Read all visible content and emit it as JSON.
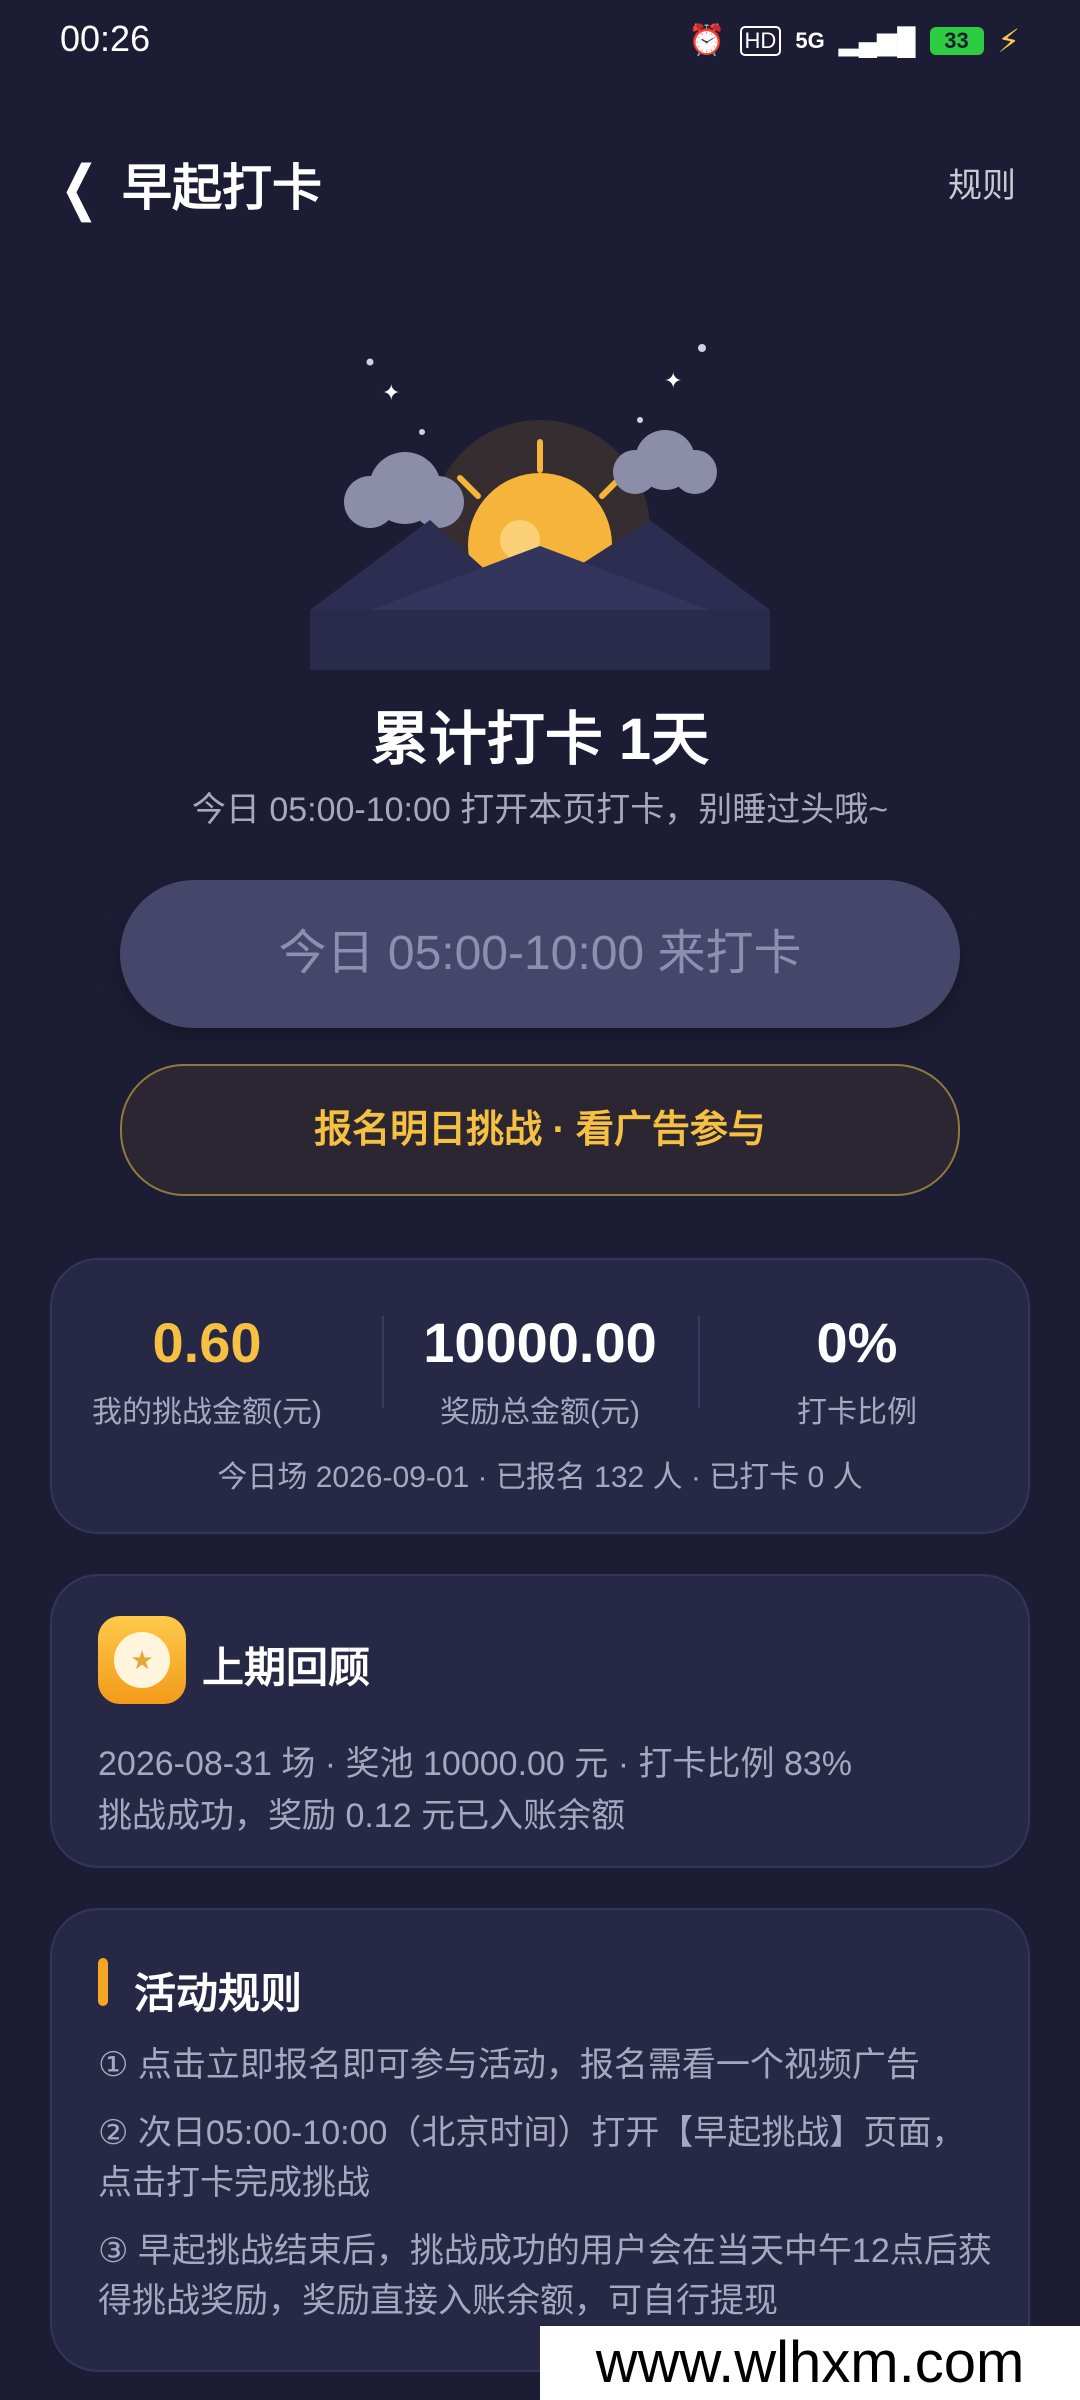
{
  "status_bar": {
    "time": "00:26",
    "battery": "33",
    "network": "5G"
  },
  "header": {
    "title": "早起打卡",
    "rules_link": "规则"
  },
  "hero": {
    "days_text": "累计打卡 1天",
    "tip": "今日 05:00-10:00 打开本页打卡，别睡过头哦~"
  },
  "buttons": {
    "checkin": "今日 05:00-10:00 来打卡",
    "signup": "报名明日挑战 · 看广告参与"
  },
  "stats": {
    "items": [
      {
        "value": "0.60",
        "label": "我的挑战金额(元)"
      },
      {
        "value": "10000.00",
        "label": "奖励总金额(元)"
      },
      {
        "value": "0%",
        "label": "打卡比例"
      }
    ],
    "footer": "今日场 2026-09-01 · 已报名 132 人 · 已打卡 0 人"
  },
  "review": {
    "title": "上期回顾",
    "line1": "2026-08-31 场 · 奖池 10000.00 元 · 打卡比例 83%",
    "line2": "挑战成功，奖励 0.12 元已入账余额"
  },
  "rules": {
    "title": "活动规则",
    "items": [
      "① 点击立即报名即可参与活动，报名需看一个视频广告",
      "② 次日05:00-10:00（北京时间）打开【早起挑战】页面，点击打卡完成挑战",
      "③ 早起挑战结束后，挑战成功的用户会在当天中午12点后获得挑战奖励，奖励直接入账余额，可自行提现"
    ]
  },
  "watermark": "www.wlhxm.com",
  "colors": {
    "background": "#1c1d35",
    "accent": "#f6c043",
    "card": "#272846"
  }
}
